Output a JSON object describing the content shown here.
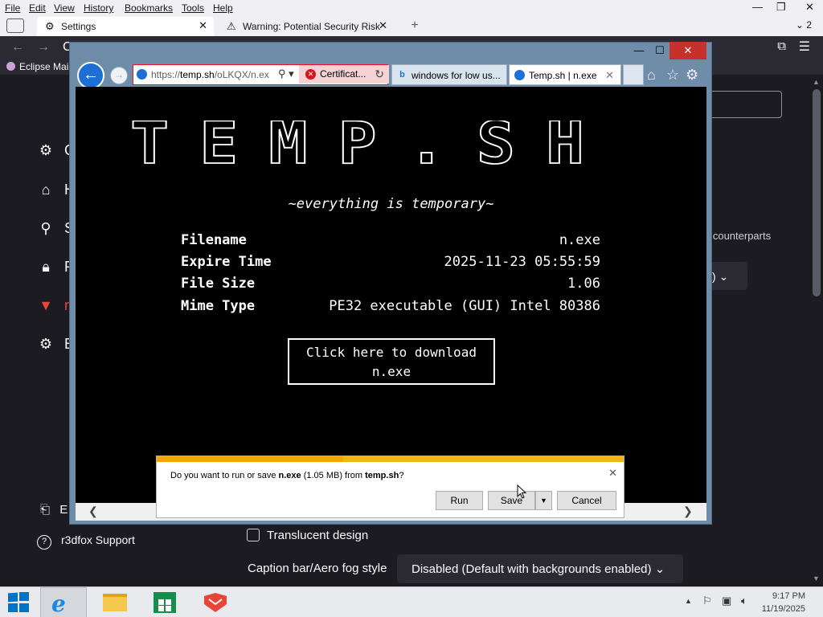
{
  "firefox": {
    "menu": [
      "File",
      "Edit",
      "View",
      "History",
      "Bookmarks",
      "Tools",
      "Help"
    ],
    "tabs": [
      {
        "label": "Settings",
        "icon": "gear-icon"
      },
      {
        "label": "Warning: Potential Security Risk",
        "icon": "warning-icon"
      }
    ],
    "tab_count": "2",
    "bookmark": "Eclipse Mai",
    "sidebar": [
      {
        "label": "G",
        "icon": "gear-icon"
      },
      {
        "label": "H",
        "icon": "home-icon"
      },
      {
        "label": "S",
        "icon": "search-icon"
      },
      {
        "label": "P",
        "icon": "lock-icon"
      },
      {
        "label": "r",
        "icon": "r3dfox-icon",
        "color": "#e8443a"
      },
      {
        "label": "E",
        "icon": "gear-icon"
      }
    ],
    "extensions_label": "E",
    "support_label": "r3dfox Support",
    "counterparts_text": "o counterparts",
    "small_dropdown_text": "lt)",
    "translucent_label": "Translucent design",
    "caption_label": "Caption bar/Aero fog style",
    "caption_value": "Disabled (Default with backgrounds enabled)"
  },
  "ie": {
    "url_prefix": "https://",
    "url_host": "temp.sh",
    "url_path": "/oLKQX/n.ex",
    "cert_label": "Certificat...",
    "tabs": [
      {
        "label": "windows for low us...",
        "icon": "bing-icon"
      },
      {
        "label": "Temp.sh | n.exe",
        "icon": "ie-icon"
      }
    ]
  },
  "page": {
    "logo": "TEMP.SH",
    "tagline": "~everything is temporary~",
    "rows": [
      {
        "label": "Filename",
        "value": "n.exe"
      },
      {
        "label": "Expire Time",
        "value": "2025-11-23 05:55:59"
      },
      {
        "label": "File Size",
        "value": "1.06"
      },
      {
        "label": "Mime Type",
        "value": "PE32 executable (GUI) Intel 80386"
      }
    ],
    "download_line1": "Click here to download",
    "download_line2": "n.exe"
  },
  "download_bar": {
    "msg_prefix": "Do you want to run or save ",
    "filename": "n.exe",
    "msg_middle": " (1.05 MB) from ",
    "site": "temp.sh",
    "msg_suffix": "?",
    "run_label": "Run",
    "save_label": "Save",
    "cancel_label": "Cancel",
    "progress": 0.4,
    "accent_color": "#f1b61a"
  },
  "taskbar": {
    "items": [
      "start-icon",
      "ie-icon",
      "file-explorer-icon",
      "store-icon",
      "r3dfox-icon"
    ],
    "time": "9:17 PM",
    "date": "11/19/2025"
  }
}
